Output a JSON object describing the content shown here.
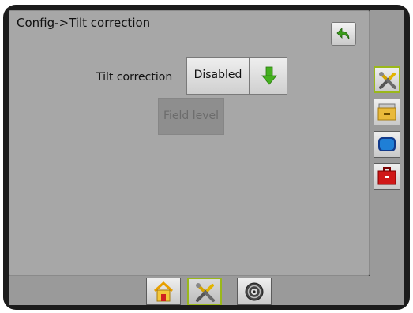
{
  "header": {
    "title": "Config->Tilt correction"
  },
  "settings": {
    "tilt_correction": {
      "label": "Tilt correction",
      "value": "Disabled"
    },
    "field_level": {
      "label": "Field level",
      "enabled": false
    }
  },
  "right_rail": [
    {
      "icon": "tools-icon",
      "selected": true
    },
    {
      "icon": "folder-icon",
      "selected": false
    },
    {
      "icon": "display-icon",
      "selected": false
    },
    {
      "icon": "toolbox-icon",
      "selected": false
    }
  ],
  "bottom_nav": [
    {
      "icon": "home-icon",
      "selected": false
    },
    {
      "icon": "tools-icon",
      "selected": true
    },
    {
      "icon": "gnss-icon",
      "selected": false
    }
  ],
  "colors": {
    "accent_selected": "#9ab81a",
    "back_arrow": "#3a9a1a",
    "dropdown_arrow": "#45b01f",
    "panel_bg": "#a7a7a7"
  }
}
